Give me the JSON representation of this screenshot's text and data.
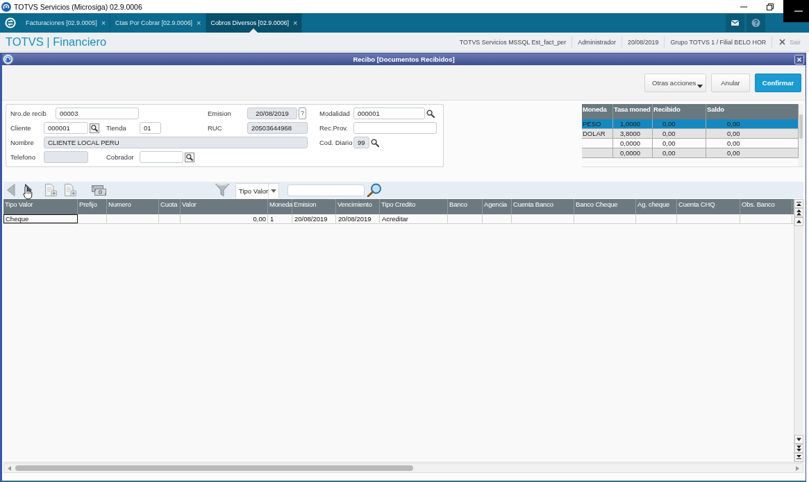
{
  "window": {
    "title": "TOTVS Servicios (Microsiga) 02.9.0006"
  },
  "tabs": [
    {
      "label": "Facturaciones [02.9.0005]",
      "close": "×",
      "selected": false
    },
    {
      "label": "Ctas Por Cobrar [02.9.0006]",
      "close": "×",
      "selected": false
    },
    {
      "label": "Cobros Diversos [02.9.0006]",
      "close": "×",
      "selected": true
    }
  ],
  "header": {
    "brand": "TOTVS | Financiero",
    "info": [
      "TOTVS Servicios MSSQL Est_fact_per",
      "Administrador",
      "20/08/2019",
      "Grupo TOTVS 1 / Filial BELO HOR"
    ],
    "exit": "Sair"
  },
  "dialog": {
    "title": "Recibo [Documentos Recibidos]",
    "buttons": [
      {
        "label": "Otras acciones",
        "kind": "menu"
      },
      {
        "label": "Anular",
        "kind": "secondary"
      },
      {
        "label": "Confirmar",
        "kind": "primary"
      }
    ]
  },
  "form": {
    "fields": [
      {
        "label": "Nro.de recib",
        "value": "00003",
        "kind": "text",
        "disabled": false
      },
      {
        "label": "Emision",
        "value": "20/08/2019",
        "kind": "date",
        "disabled": true,
        "help_button": "?"
      },
      {
        "label": "Modalidad",
        "value": "000001",
        "kind": "search",
        "disabled": false
      },
      {
        "label": "Cliente",
        "value": "000001",
        "kind": "lookup",
        "disabled": false
      },
      {
        "label": "Tienda",
        "value": "01",
        "kind": "text",
        "disabled": false
      },
      {
        "label": "RUC",
        "value": "20503644968",
        "kind": "text",
        "disabled": true
      },
      {
        "label": "Rec.Prov.",
        "kind": "text",
        "disabled": false
      },
      {
        "label": "Nombre",
        "value": "CLIENTE LOCAL PERU",
        "kind": "text",
        "disabled": true
      },
      {
        "label": "Cod. Diario",
        "value": "99",
        "kind": "search",
        "disabled": true
      },
      {
        "label": "Telefono",
        "kind": "text",
        "disabled": true
      },
      {
        "label": "Cobrador",
        "kind": "lookup",
        "disabled": false
      }
    ]
  },
  "currency_table": {
    "columns": [
      "Moneda",
      "Tasa moned",
      "Recibido",
      "Saldo"
    ],
    "rows": [
      {
        "cells": [
          "PESO",
          "1,0000",
          "0,00",
          "0,00"
        ],
        "selected": true
      },
      {
        "cells": [
          "DOLAR",
          "3,8000",
          "0,00",
          "0,00"
        ],
        "selected": false
      },
      {
        "cells": [
          "",
          "0,0000",
          "0,00",
          "0,00"
        ],
        "selected": false
      },
      {
        "cells": [
          "",
          "0,0000",
          "0,00",
          "0,00"
        ],
        "selected": false
      }
    ]
  },
  "grid_toolbar": {
    "filter_select": {
      "value": "Tipo Valor"
    }
  },
  "grid": {
    "columns": [
      "Tipo Valor",
      "Prefijo",
      "Numero",
      "Cuota",
      "Valor",
      "Moneda",
      "Emision",
      "Vencimiento",
      "Tipo Credito",
      "Banco",
      "Agencia",
      "Cuenta Banco",
      "Banco Cheque",
      "Ag. cheque",
      "Cuenta CHQ",
      "Obs. Banco"
    ],
    "rows": [
      {
        "cells": [
          {
            "text": "Cheque",
            "focused": true
          },
          {
            "text": "",
            "focused": false
          },
          {
            "text": "",
            "focused": false
          },
          {
            "text": "",
            "focused": false
          },
          {
            "text": "0,00",
            "focused": false
          },
          {
            "text": "1",
            "focused": false
          },
          {
            "text": "20/08/2019",
            "focused": false
          },
          {
            "text": "20/08/2019",
            "focused": false
          },
          {
            "text": "Acreditar",
            "focused": false
          },
          {
            "text": "",
            "focused": false
          },
          {
            "text": "",
            "focused": false
          },
          {
            "text": "",
            "focused": false
          },
          {
            "text": "",
            "focused": false
          },
          {
            "text": "",
            "focused": false
          },
          {
            "text": "",
            "focused": false
          },
          {
            "text": "",
            "focused": false
          }
        ]
      }
    ]
  }
}
